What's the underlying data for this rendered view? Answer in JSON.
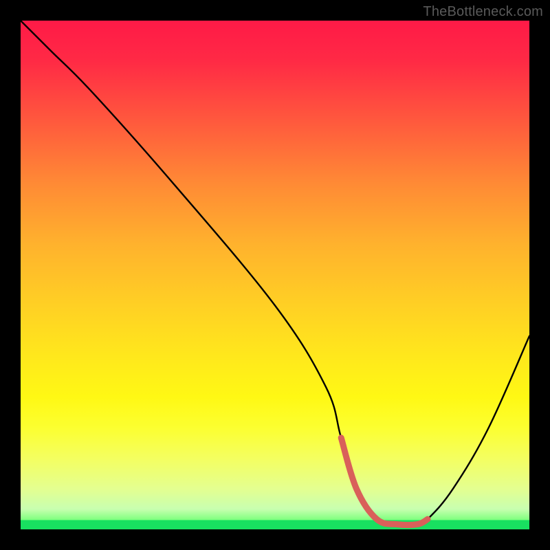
{
  "watermark": "TheBottleneck.com",
  "chart_data": {
    "type": "line",
    "title": "",
    "xlabel": "",
    "ylabel": "",
    "xlim": [
      0,
      100
    ],
    "ylim": [
      0,
      100
    ],
    "series": [
      {
        "name": "bottleneck-curve",
        "x": [
          0,
          6,
          14,
          30,
          50,
          60,
          63,
          66,
          70,
          74,
          78,
          80,
          85,
          92,
          100
        ],
        "values": [
          100,
          94,
          86,
          68,
          44,
          28,
          18,
          8,
          2,
          1,
          1,
          2,
          8,
          20,
          38
        ]
      }
    ],
    "highlight_segment": {
      "name": "low-bottleneck-region",
      "x": [
        63,
        66,
        70,
        74,
        78,
        80
      ],
      "values": [
        18,
        8,
        2,
        1,
        1,
        2
      ]
    },
    "gradient_stops": [
      {
        "pos": 0.0,
        "color": "#ff1a47"
      },
      {
        "pos": 0.5,
        "color": "#ffd024"
      },
      {
        "pos": 0.96,
        "color": "#c8ffb0"
      },
      {
        "pos": 0.982,
        "color": "#18e060"
      },
      {
        "pos": 1.0,
        "color": "#18e060"
      }
    ]
  }
}
